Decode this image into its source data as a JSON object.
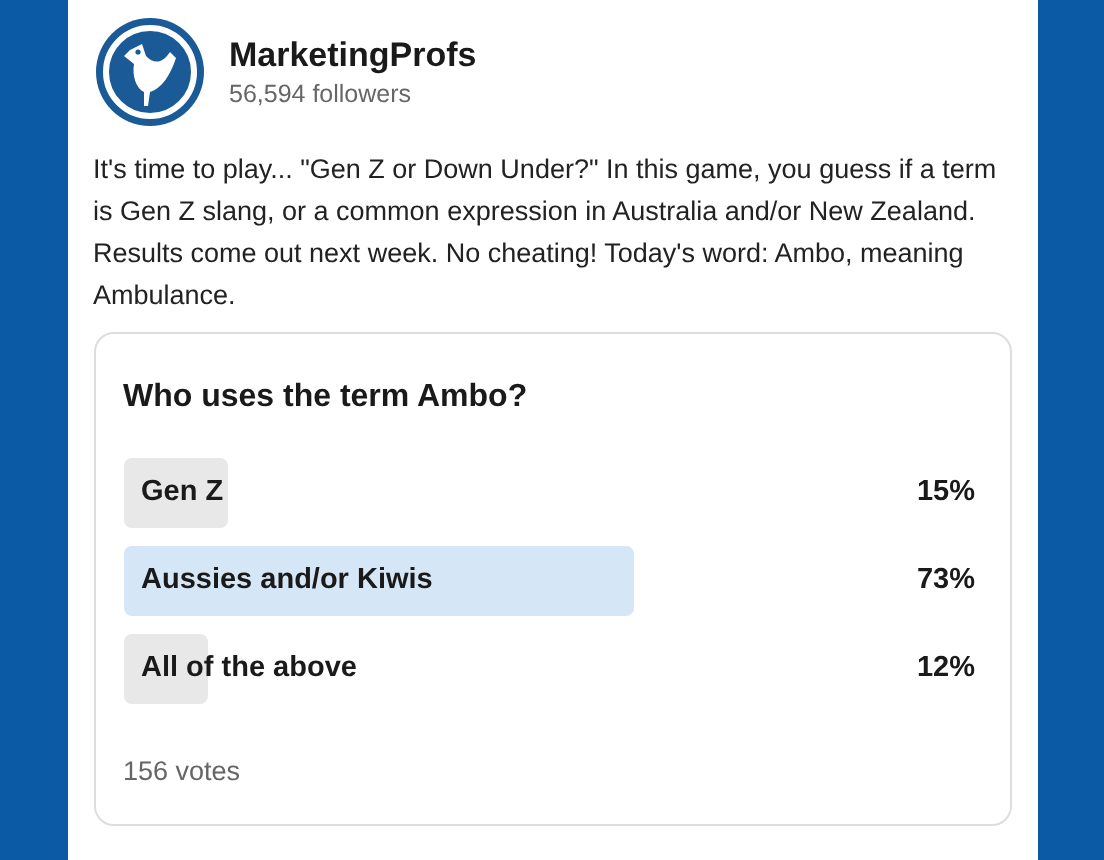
{
  "author": {
    "name": "MarketingProfs",
    "followers": "56,594 followers"
  },
  "post_text": "It's time to play... \"Gen Z or Down Under?\" In this game, you guess if a term is Gen Z slang, or a common expression in Australia and/or New Zealand. Results come out next week. No cheating! Today's word: Ambo, meaning Ambulance.",
  "poll": {
    "question": "Who uses the term Ambo?",
    "options": [
      {
        "label": "Gen Z",
        "percent": "15%",
        "level": 0.15,
        "selected": false
      },
      {
        "label": "Aussies and/or Kiwis",
        "percent": "73%",
        "level": 0.73,
        "selected": true
      },
      {
        "label": "All of the above",
        "percent": "12%",
        "level": 0.12,
        "selected": false
      }
    ],
    "votes": "156 votes"
  }
}
